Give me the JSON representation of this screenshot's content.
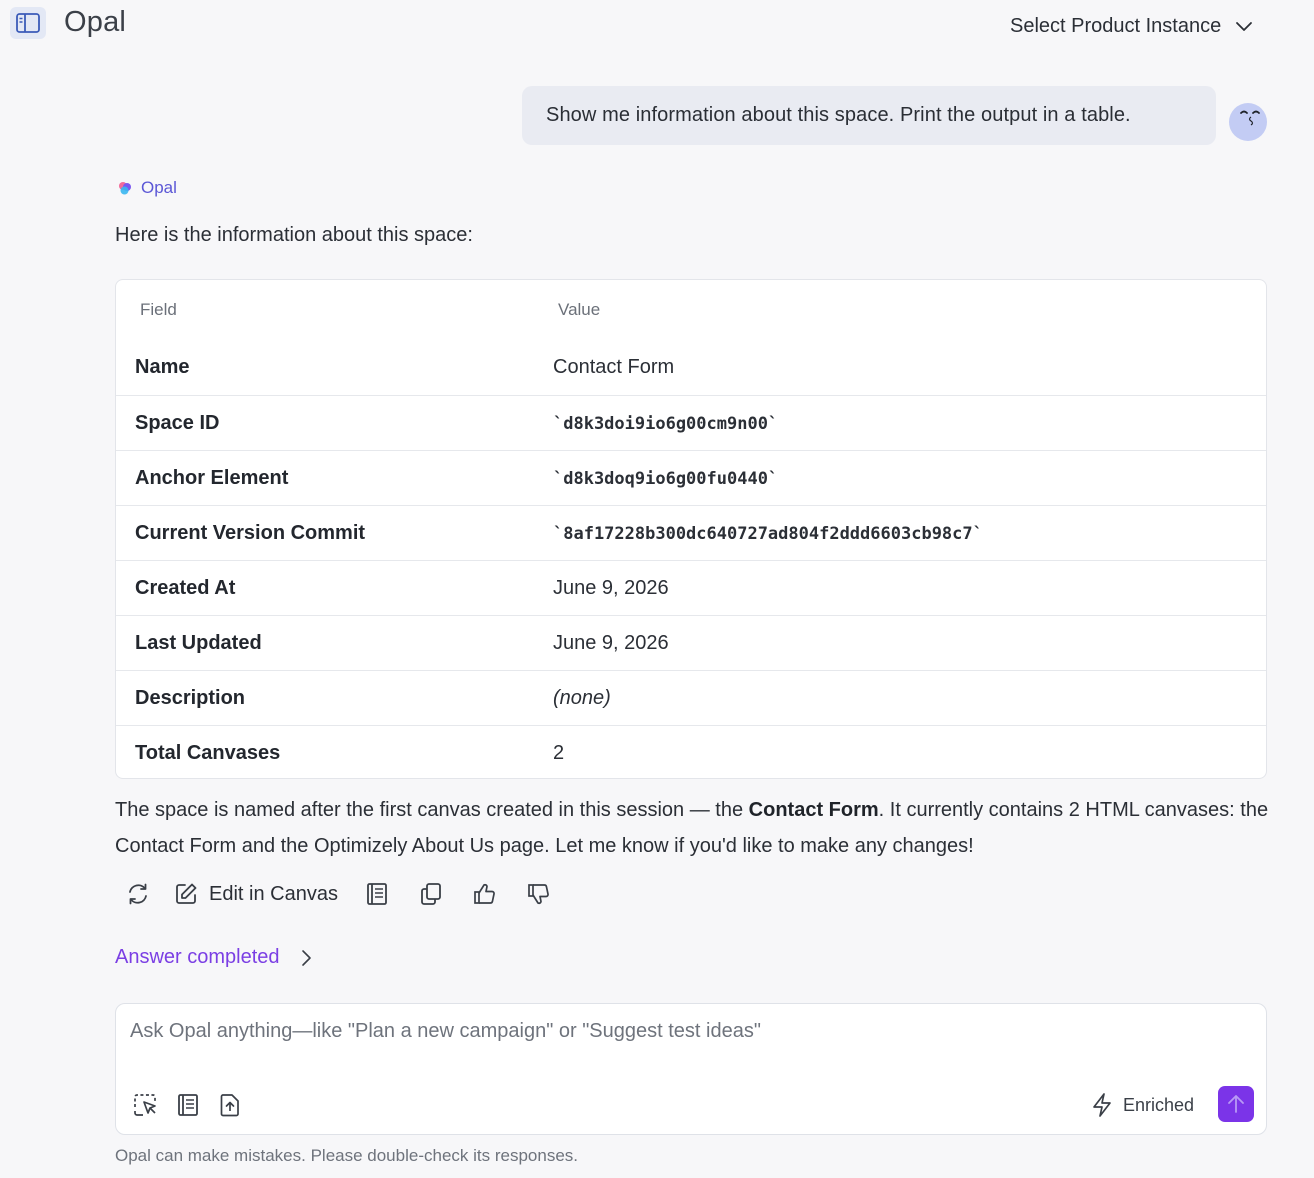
{
  "header": {
    "app_title": "Opal",
    "instance_select_label": "Select Product Instance"
  },
  "user_message": {
    "text": "Show me information about this space. Print the output in a table."
  },
  "assistant": {
    "name": "Opal",
    "intro": "Here is the information about this space:",
    "table": {
      "headers": [
        "Field",
        "Value"
      ],
      "rows": [
        {
          "field": "Name",
          "value": "Contact Form",
          "style": "plain"
        },
        {
          "field": "Space ID",
          "value": "`d8k3doi9io6g00cm9n00`",
          "style": "mono"
        },
        {
          "field": "Anchor Element",
          "value": "`d8k3doq9io6g00fu0440`",
          "style": "mono"
        },
        {
          "field": "Current Version Commit",
          "value": "`8af17228b300dc640727ad804f2ddd6603cb98c7`",
          "style": "mono"
        },
        {
          "field": "Created At",
          "value": "June 9, 2026",
          "style": "plain"
        },
        {
          "field": "Last Updated",
          "value": "June 9, 2026",
          "style": "plain"
        },
        {
          "field": "Description",
          "value": "(none)",
          "style": "italic"
        },
        {
          "field": "Total Canvases",
          "value": "2",
          "style": "plain"
        }
      ]
    },
    "summary": {
      "part1": "The space is named after the first canvas created in this session — the ",
      "bold": "Contact Form",
      "part2": ". It currently contains 2 HTML canvases: the Contact Form and the Optimizely About Us page. Let me know if you'd like to make any changes!"
    },
    "actions": {
      "edit_in_canvas_label": "Edit in Canvas",
      "icons": [
        "regenerate-icon",
        "edit-icon",
        "notebook-icon",
        "copy-icon",
        "thumbs-up-icon",
        "thumbs-down-icon"
      ]
    },
    "status_label": "Answer completed"
  },
  "composer": {
    "placeholder": "Ask Opal anything—like \"Plan a new campaign\" or \"Suggest test ideas\"",
    "value": "",
    "enriched_label": "Enriched"
  },
  "disclaimer": "Opal can make mistakes. Please double-check its responses.",
  "colors": {
    "accent_purple": "#7b34e8",
    "link_purple": "#7b3fe4",
    "opal_label": "#5b57d6",
    "background": "#f7f7f9",
    "user_bubble": "#e9ebf2"
  }
}
